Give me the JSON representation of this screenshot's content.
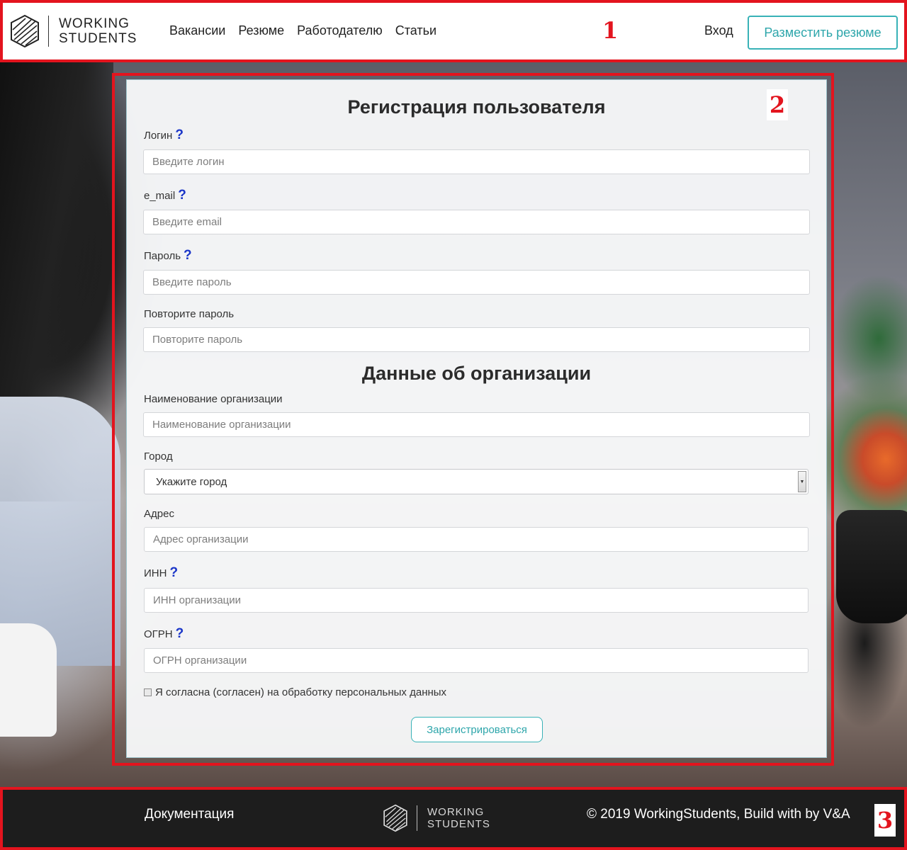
{
  "header": {
    "logo_line1": "WORKING",
    "logo_line2": "STUDENTS",
    "nav": [
      "Вакансии",
      "Резюме",
      "Работодателю",
      "Статьи"
    ],
    "region_marker": "1",
    "login_label": "Вход",
    "post_resume_label": "Разместить резюме"
  },
  "form": {
    "region_marker": "2",
    "title": "Регистрация пользователя",
    "login": {
      "label": "Логин",
      "help": "?",
      "placeholder": "Введите логин"
    },
    "email": {
      "label": "e_mail",
      "help": "?",
      "placeholder": "Введите email"
    },
    "password": {
      "label": "Пароль",
      "help": "?",
      "placeholder": "Введите пароль"
    },
    "password_repeat": {
      "label": "Повторите пароль",
      "placeholder": "Повторите пароль"
    },
    "org_title": "Данные об организации",
    "org_name": {
      "label": "Наименование организации",
      "placeholder": "Наименование организации"
    },
    "city": {
      "label": "Город",
      "selected": "Укажите город"
    },
    "address": {
      "label": "Адрес",
      "placeholder": "Адрес организации"
    },
    "inn": {
      "label": "ИНН",
      "help": "?",
      "placeholder": "ИНН организации"
    },
    "ogrn": {
      "label": "ОГРН",
      "help": "?",
      "placeholder": "ОГРН организации"
    },
    "consent_label": "Я согласна (согласен) на обработку персональных данных",
    "submit_label": "Зарегистрироваться"
  },
  "footer": {
    "docs_label": "Документация",
    "logo_line1": "WORKING",
    "logo_line2": "STUDENTS",
    "copyright": "© 2019 WorkingStudents, Build with by V&A",
    "region_marker": "3"
  },
  "colors": {
    "accent": "#38b2b7",
    "marker_red": "#e3141e",
    "help_blue": "#1a35c8",
    "footer_bg": "#1d1d1d"
  }
}
